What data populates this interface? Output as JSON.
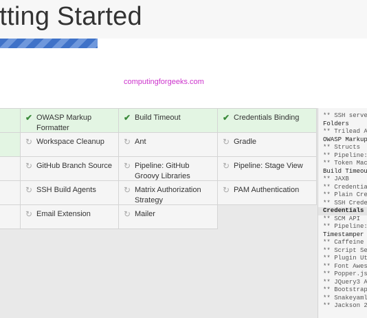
{
  "header": {
    "title": "etting Started"
  },
  "progress": {
    "fraction": 0.265
  },
  "watermark": "computingforgeeks.com",
  "plugins": [
    {
      "name": "OWASP Markup Formatter",
      "status": "installed"
    },
    {
      "name": "Build Timeout",
      "status": "installed"
    },
    {
      "name": "Credentials Binding",
      "status": "installed"
    },
    {
      "name": "Workspace Cleanup",
      "status": "pending"
    },
    {
      "name": "Ant",
      "status": "pending"
    },
    {
      "name": "Gradle",
      "status": "pending"
    },
    {
      "name": "GitHub Branch Source",
      "status": "pending"
    },
    {
      "name": "Pipeline: GitHub Groovy Libraries",
      "status": "pending"
    },
    {
      "name": "Pipeline: Stage View",
      "status": "pending"
    },
    {
      "name": "SSH Build Agents",
      "status": "pending"
    },
    {
      "name": "Matrix Authorization Strategy",
      "status": "pending"
    },
    {
      "name": "PAM Authentication",
      "status": "pending"
    },
    {
      "name": "Email Extension",
      "status": "pending"
    },
    {
      "name": "Mailer",
      "status": "pending"
    }
  ],
  "log": [
    {
      "text": "** SSH serve",
      "kind": "dep"
    },
    {
      "text": "Folders",
      "kind": "head"
    },
    {
      "text": "** Trilead A",
      "kind": "dep"
    },
    {
      "text": "OWASP Markup",
      "kind": "head"
    },
    {
      "text": "** Structs",
      "kind": "dep"
    },
    {
      "text": "** Pipeline:",
      "kind": "dep"
    },
    {
      "text": "** Token Mac",
      "kind": "dep"
    },
    {
      "text": "Build Timeou",
      "kind": "head"
    },
    {
      "text": "** JAXB",
      "kind": "dep"
    },
    {
      "text": "** Credentia",
      "kind": "dep"
    },
    {
      "text": "** Plain Cre",
      "kind": "dep"
    },
    {
      "text": "** SSH Crede",
      "kind": "dep"
    },
    {
      "text": "Credentials",
      "kind": "hl"
    },
    {
      "text": "** SCM API",
      "kind": "dep"
    },
    {
      "text": "** Pipeline:",
      "kind": "dep"
    },
    {
      "text": "Timestamper",
      "kind": "head"
    },
    {
      "text": "** Caffeine",
      "kind": "dep"
    },
    {
      "text": "** Script Se",
      "kind": "dep"
    },
    {
      "text": "** Plugin Ut",
      "kind": "dep"
    },
    {
      "text": "** Font Awes",
      "kind": "dep"
    },
    {
      "text": "** Popper.js",
      "kind": "dep"
    },
    {
      "text": "** JQuery3 A",
      "kind": "dep"
    },
    {
      "text": "** Bootstrap",
      "kind": "dep"
    },
    {
      "text": "** Snakeyaml",
      "kind": "dep"
    },
    {
      "text": "** Jackson 2",
      "kind": "dep"
    }
  ],
  "icons": {
    "installed": "check-icon",
    "pending": "refresh-icon"
  },
  "colors": {
    "installed_bg": "#e3f5e3",
    "check": "#3a8a3a",
    "progress": "#3f72c8"
  }
}
